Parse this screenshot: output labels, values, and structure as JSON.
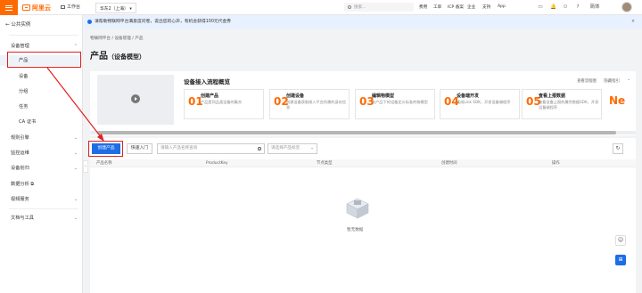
{
  "topbar": {
    "logo_text": "阿里云",
    "workspace": "工作台",
    "region": "华东2（上海）",
    "search_placeholder": "搜索...",
    "links": [
      "费用",
      "工单",
      "ICP 备案",
      "企业",
      "支持",
      "App"
    ]
  },
  "sidebar": {
    "back_label": "公共实例",
    "groups": [
      {
        "label": "设备管理",
        "children": [
          "产品",
          "设备",
          "分组",
          "任务",
          "CA 证书"
        ]
      },
      {
        "label": "规则引擎"
      },
      {
        "label": "监控运维"
      },
      {
        "label": "设备划归"
      },
      {
        "label": "数据分析 ⧉"
      },
      {
        "label": "视频服务"
      },
      {
        "label": "文档与工具"
      }
    ],
    "active_item": "产品"
  },
  "notice": {
    "text": "请帮助物联网平台满意度问卷，说出您的心声，有机会获得100元代金券",
    "close": "×"
  },
  "breadcrumb": [
    "物联网平台",
    "设备管理",
    "产品"
  ],
  "page": {
    "title": "产品",
    "subtitle": "（设备模型）"
  },
  "flow": {
    "title": "设备接入流程概览",
    "link_guide": "查看流程图",
    "link_hide": "隐藏指引",
    "steps": [
      {
        "num": "01",
        "title": "创建产品",
        "desc": "产品是同品类设备的集合"
      },
      {
        "num": "02",
        "title": "创建设备",
        "desc": "创建设备获取接入平台所需的身份信息"
      },
      {
        "num": "03",
        "title": "编辑物模型",
        "desc": "为产品下的设备定义标准的物模型"
      },
      {
        "num": "04",
        "title": "设备端开发",
        "desc": "集成Link SDK，开发设备端程序"
      },
      {
        "num": "05",
        "title": "查看上报数据",
        "desc": "查看设备上报的属性数据SDK，开发设备端程序"
      }
    ],
    "next_partial": "Ne"
  },
  "toolbar": {
    "create_label": "创建产品",
    "quick_label": "快速入门",
    "search_placeholder": "请输入产品名称查询",
    "tag_placeholder": "请选择产品标签",
    "refresh_icon": "refresh-icon"
  },
  "table": {
    "columns": [
      "产品名称",
      "ProductKey",
      "节点类型",
      "创建时间",
      "操作"
    ],
    "empty_text": "暂无数据"
  },
  "colors": {
    "brand": "#ff6a00",
    "primary": "#1d6ee5",
    "highlight": "#e02020"
  }
}
